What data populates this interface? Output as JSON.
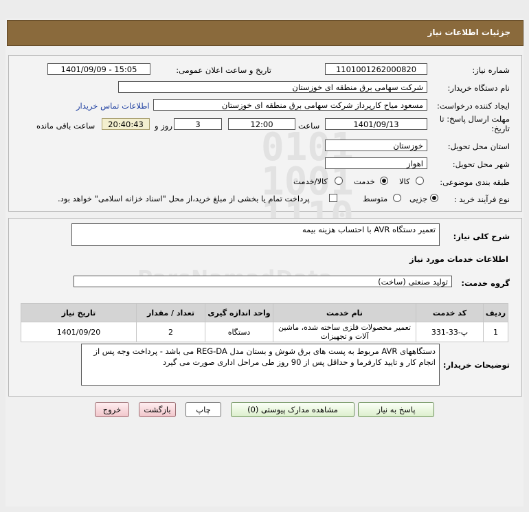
{
  "header": {
    "title": "جزئیات اطلاعات نیاز"
  },
  "form": {
    "need_number_label": "شماره نیاز:",
    "need_number": "1101001262000820",
    "announce_label": "تاریخ و ساعت اعلان عمومی:",
    "announce_value": "1401/09/09 - 15:05",
    "buyer_org_label": "نام دستگاه خریدار:",
    "buyer_org": "شرکت سهامی برق منطقه ای خوزستان",
    "creator_label": "ایجاد کننده درخواست:",
    "creator": "مسعود میاح کارپرداز شرکت سهامی برق منطقه ای خوزستان",
    "contact_link": "اطلاعات تماس خریدار",
    "deadline_label": "مهلت ارسال پاسخ: تا تاریخ:",
    "deadline_date": "1401/09/13",
    "hour_label": "ساعت",
    "deadline_time": "12:00",
    "days_value": "3",
    "days_label": "روز و",
    "remaining_time": "20:40:43",
    "remaining_label": "ساعت باقی مانده",
    "province_label": "استان محل تحویل:",
    "province": "خوزستان",
    "city_label": "شهر محل تحویل:",
    "city": "اهواز",
    "category_label": "طبقه بندی موضوعی:",
    "category_options": [
      "کالا",
      "خدمت",
      "کالا/خدمت"
    ],
    "category_selected": "خدمت",
    "process_label": "نوع فرآیند خرید :",
    "process_options": [
      "جزیی",
      "متوسط"
    ],
    "process_selected": "جزیی",
    "payment_note": "پرداخت تمام یا بخشی از مبلغ خرید،از محل \"اسناد خزانه اسلامی\" خواهد بود."
  },
  "details": {
    "summary_label": "شرح کلی نیاز:",
    "summary": "تعمیر دستگاه AVR با احتساب هزینه بیمه",
    "services_heading": "اطلاعات خدمات مورد نیاز",
    "service_group_label": "گروه خدمت:",
    "service_group": "تولید صنعتی (ساخت)",
    "table_headers": [
      "ردیف",
      "کد خدمت",
      "نام خدمت",
      "واحد اندازه گیری",
      "تعداد / مقدار",
      "تاریخ نیاز"
    ],
    "table_rows": [
      [
        "1",
        "پ-33-331",
        "تعمیر محصولات فلزی ساخته شده، ماشین آلات و تجهیزات",
        "دستگاه",
        "2",
        "1401/09/20"
      ]
    ],
    "buyer_notes_label": "توضیحات خریدار:",
    "buyer_notes": "دستگاههای AVR مربوط به پست های برق شوش و بستان  مدل  REG-DA می باشد - پرداخت وجه پس از انجام کار و تایید کارفرما و حداقل پس از 90 روز طی مراحل اداری صورت می گیرد"
  },
  "buttons": {
    "reply": "پاسخ به نیاز",
    "attachments": "مشاهده مدارک پیوستی (0)",
    "print": "چاپ",
    "back": "بازگشت",
    "exit": "خروج"
  },
  "colors": {
    "header_bg": "#8a6a3c",
    "link": "#1d3ea0",
    "timer_bg": "#f3efcf"
  }
}
